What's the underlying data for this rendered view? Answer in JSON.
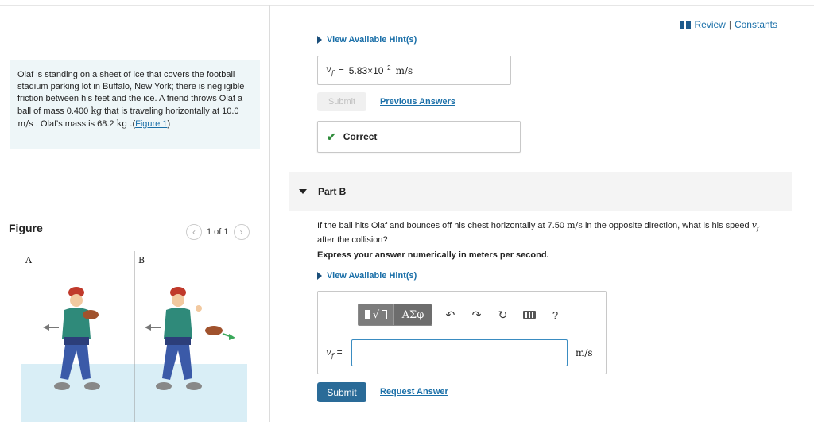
{
  "header": {
    "review_label": "Review",
    "separator": "|",
    "constants_label": "Constants"
  },
  "problem": {
    "text_1": "Olaf is standing on a sheet of ice that covers the football stadium parking lot in Buffalo, New York; there is negligible friction between his feet and the ice. A friend throws Olaf a ball of mass 0.400 ",
    "unit_kg_1": "kg",
    "text_2": " that is traveling horizontally at 10.0 ",
    "unit_ms_1": "m/s",
    "text_3": " . Olaf's mass is 68.2 ",
    "unit_kg_2": "kg",
    "text_4": " .(",
    "figure_link": "Figure 1",
    "text_5": ")"
  },
  "figure": {
    "title": "Figure",
    "pager": "1 of 1",
    "panel_a_label": "A",
    "panel_b_label": "B"
  },
  "part_a": {
    "hint_label": "View Available Hint(s)",
    "answer_var": "v",
    "answer_sub": "f",
    "answer_eq": "=",
    "answer_value": "5.83×10",
    "answer_exp": "−2",
    "answer_unit": "m/s",
    "submit_label": "Submit",
    "previous_answers_label": "Previous Answers",
    "status_label": "Correct"
  },
  "part_b": {
    "title": "Part B",
    "question_1": "If the ball hits Olaf and bounces off his chest horizontally at 7.50 ",
    "question_unit": "m/s",
    "question_2": " in the opposite direction, what is his speed ",
    "question_var": "v",
    "question_sub": "f",
    "question_3": " after the collision?",
    "instruction": "Express your answer numerically in meters per second.",
    "hint_label": "View Available Hint(s)",
    "toolbar": {
      "greek_label": "ΑΣφ",
      "radical": "√",
      "undo_icon": "undo-icon",
      "redo_icon": "redo-icon",
      "reset_icon": "reset-icon",
      "keyboard_icon": "keyboard-icon",
      "help_label": "?"
    },
    "input_var": "v",
    "input_sub": "f",
    "input_eq": "=",
    "input_value": "",
    "input_unit": "m/s",
    "submit_label": "Submit",
    "request_answer_label": "Request Answer"
  },
  "colors": {
    "link": "#1a6fa8",
    "submit_bg": "#2a6b98",
    "correct_check": "#2e8b3a",
    "problem_bg": "#eef6f8"
  }
}
